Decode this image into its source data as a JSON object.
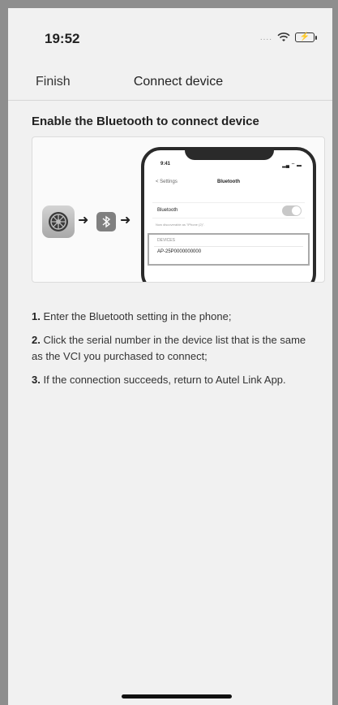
{
  "status": {
    "time": "19:52"
  },
  "nav": {
    "finish": "Finish",
    "title": "Connect device"
  },
  "heading": "Enable the Bluetooth to connect device",
  "illustration": {
    "time": "9:41",
    "back": "< Settings",
    "title": "Bluetooth",
    "bluetooth_label": "Bluetooth",
    "discoverable": "Now discoverable as \"iPhone (2)\".",
    "devices_label": "DEVICES",
    "device_serial": "AP-25P0000000000"
  },
  "steps": [
    {
      "num": "1.",
      "text": " Enter the Bluetooth setting in the phone;"
    },
    {
      "num": "2.",
      "text": " Click the serial number in the device list that is the same as the VCI you purchased to connect;"
    },
    {
      "num": "3.",
      "text": " If the connection succeeds, return to Autel Link App."
    }
  ]
}
